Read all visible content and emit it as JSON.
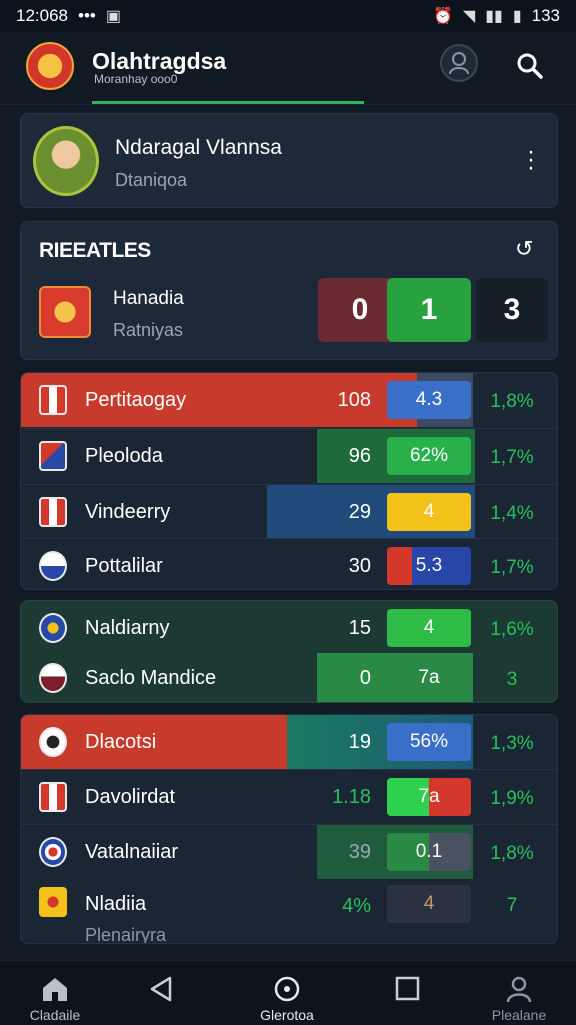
{
  "status": {
    "time": "12:068",
    "dots": "•••",
    "battery": "133"
  },
  "header": {
    "title": "Olahtragdsa",
    "subtitle": "Moranhay ooo0"
  },
  "profile": {
    "name": "Ndaragal Vlannsa",
    "subtitle": "Dtaniqoa"
  },
  "results": {
    "title": "RIEEATLES",
    "refresh_icon": "refresh-icon",
    "team_name": "Hanadia",
    "team_sub": "Ratniyas",
    "scores": [
      "0",
      "1",
      "3"
    ]
  },
  "standings": [
    {
      "name": "Pertitaogay",
      "value": "108",
      "pill": "4.3",
      "pct": "1,8%",
      "pill_color": "#3a6fc9",
      "row_color": "#c83a2c"
    },
    {
      "name": "Pleoloda",
      "value": "96",
      "pill": "62%",
      "pct": "1,7%",
      "pill_color": "#29b04a",
      "row_color": ""
    },
    {
      "name": "Vindeerry",
      "value": "29",
      "pill": "4",
      "pct": "1,4%",
      "pill_color": "#f2c21b",
      "row_color": ""
    },
    {
      "name": "Pottalilar",
      "value": "30",
      "pill": "5.3",
      "pct": "1,7%",
      "pill_color": "#2846a8",
      "row_color": ""
    },
    {
      "name": "Naldiarny",
      "value": "15",
      "pill": "4",
      "pct": "1,6%",
      "pill_color": "#2ebc46",
      "row_color": ""
    },
    {
      "name": "Saclo Mandice",
      "value": "0",
      "pill": "7a",
      "pct": "3",
      "pill_color": "#2a8a45",
      "row_color": ""
    },
    {
      "name": "Dlacotsi",
      "value": "19",
      "pill": "56%",
      "pct": "1,3%",
      "pill_color": "#3a6fc9",
      "row_color": "#c83a2c"
    },
    {
      "name": "Davolirdat",
      "value": "1.18",
      "pill": "7a",
      "pct": "1,9%",
      "pill_color": "#2fd14e",
      "row_color": ""
    },
    {
      "name": "Vatalnaiiar",
      "value": "39",
      "pill": "0.1",
      "pct": "1,8%",
      "pill_color": "#4a5160",
      "row_color": ""
    },
    {
      "name": "Nladiia",
      "value": "4%",
      "pill": "4",
      "pct": "7",
      "pill_color": "#2a3140",
      "row_color": ""
    }
  ],
  "footer_sub": "Plenairyra",
  "nav": [
    {
      "label": "Cladaile",
      "icon": "home-icon"
    },
    {
      "label": "",
      "icon": "back-icon"
    },
    {
      "label": "Glerotoa",
      "icon": "compass-icon"
    },
    {
      "label": "",
      "icon": "square-icon"
    },
    {
      "label": "Plealane",
      "icon": "person-icon"
    }
  ]
}
